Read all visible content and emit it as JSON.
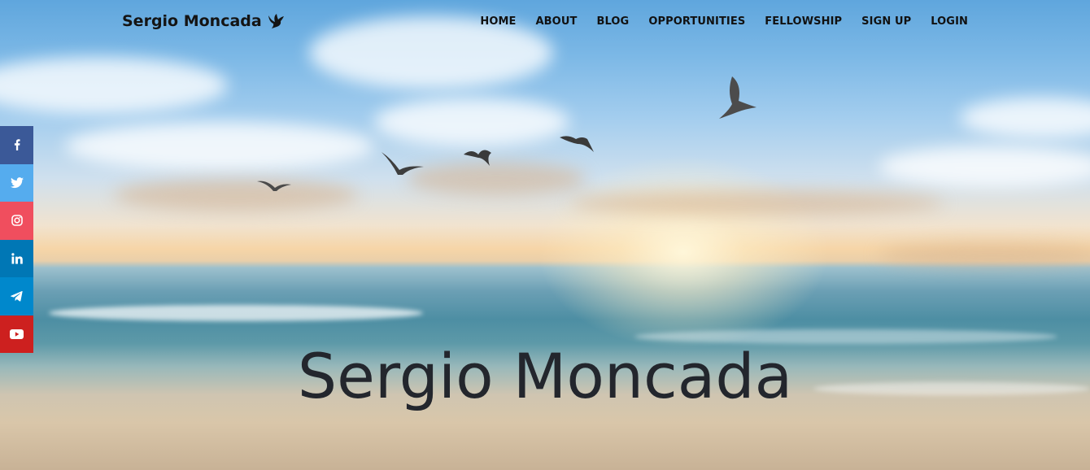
{
  "brand": {
    "name": "Sergio Moncada",
    "logo_icon": "dove-icon"
  },
  "nav": {
    "items": [
      {
        "label": "HOME"
      },
      {
        "label": "ABOUT"
      },
      {
        "label": "BLOG"
      },
      {
        "label": "OPPORTUNITIES"
      },
      {
        "label": "FELLOWSHIP"
      },
      {
        "label": "SIGN UP"
      },
      {
        "label": "LOGIN"
      }
    ]
  },
  "social": [
    {
      "name": "facebook",
      "icon": "facebook-icon",
      "color": "#3b5998"
    },
    {
      "name": "twitter",
      "icon": "twitter-icon",
      "color": "#55acee"
    },
    {
      "name": "instagram",
      "icon": "instagram-icon",
      "color": "#f04e5e"
    },
    {
      "name": "linkedin",
      "icon": "linkedin-icon",
      "color": "#0077b5"
    },
    {
      "name": "telegram",
      "icon": "telegram-icon",
      "color": "#0088cc"
    },
    {
      "name": "youtube",
      "icon": "youtube-icon",
      "color": "#cd201f"
    }
  ],
  "hero": {
    "title": "Sergio Moncada"
  }
}
